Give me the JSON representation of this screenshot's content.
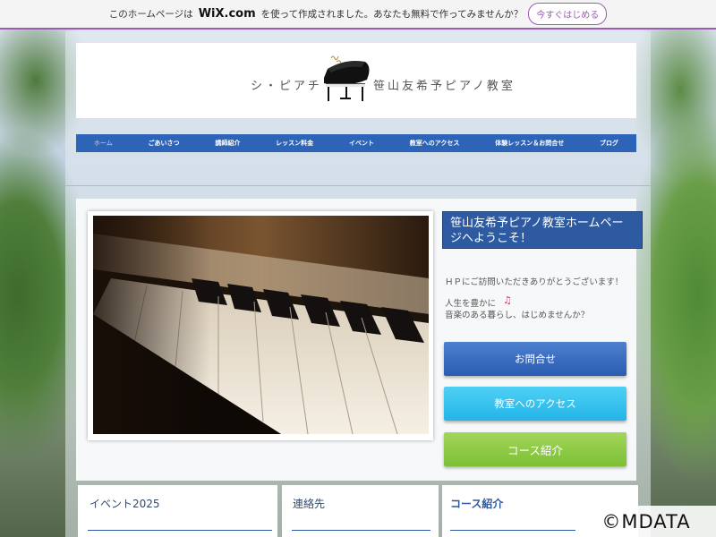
{
  "wix_banner": {
    "text_before": "このホームページは",
    "logo": "WiX.com",
    "text_after": "を使って作成されました。あなたも無料で作ってみませんか？",
    "cta": "今すぐはじめる"
  },
  "site": {
    "logo_left": "シ・ピアチェ",
    "logo_right": "笹山友希予ピアノ教室",
    "logo_icon": "grand-piano-icon"
  },
  "nav": {
    "items": [
      "ホーム",
      "ごあいさつ",
      "講師紹介",
      "レッスン料金",
      "イベント",
      "教室へのアクセス",
      "体験レッスン＆お問合せ",
      "ブログ"
    ]
  },
  "main": {
    "welcome_title": "笹山友希予ピアノ教室ホームページへようこそ！",
    "greeting": "ＨＰにご訪問いただきありがとうございます！",
    "line1": "人生を豊かに",
    "note_icon": "music-note-icon",
    "note_glyph": "♫",
    "line2": "音楽のある暮らし、はじめませんか？",
    "buttons": {
      "contact": "お問合せ",
      "access": "教室へのアクセス",
      "course": "コース紹介"
    }
  },
  "footer": {
    "event": "イベント2025",
    "contact": "連絡先",
    "course": "コース紹介"
  },
  "watermark": "©MDATA",
  "colors": {
    "nav_bg": "#2e64b8",
    "welcome_bg": "#2d5aa0",
    "btn_contact": "#3a6ec2",
    "btn_access": "#2fbeee",
    "btn_course": "#8cc844",
    "wix_accent": "#9b5bb0"
  }
}
